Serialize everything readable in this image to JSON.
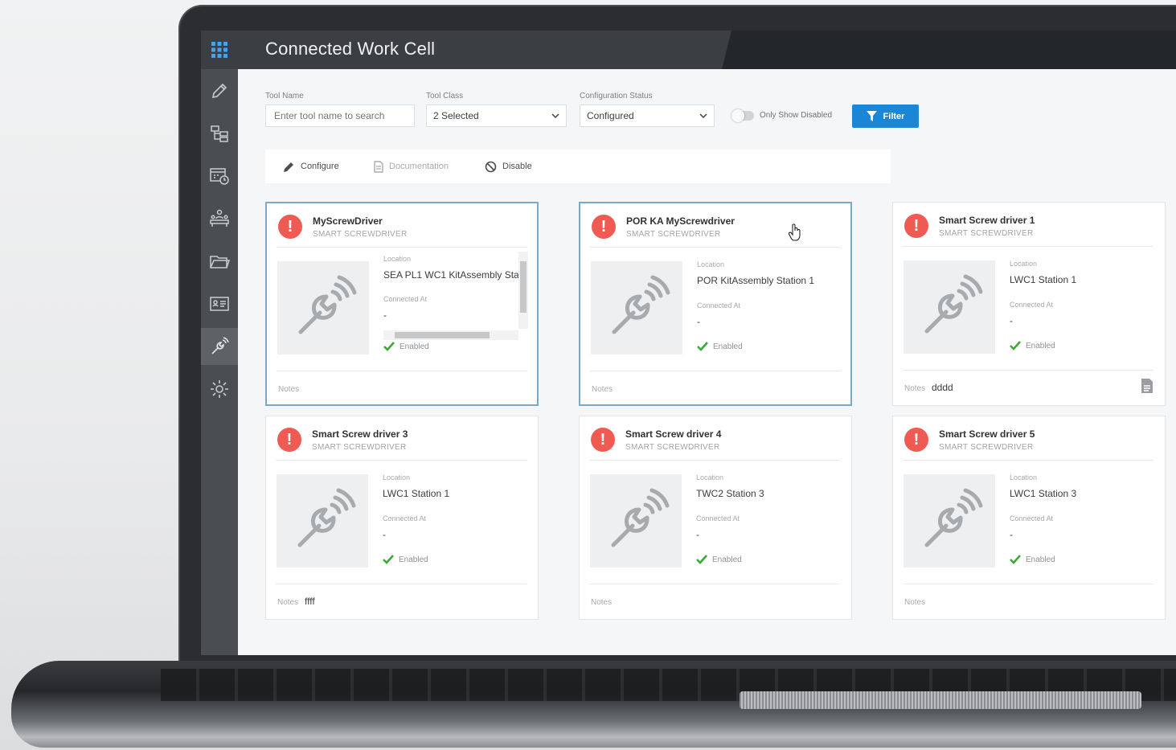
{
  "app": {
    "title": "Connected Work Cell"
  },
  "sidebar": {
    "items": [
      {
        "icon": "pencil-icon"
      },
      {
        "icon": "hierarchy-icon"
      },
      {
        "icon": "schedule-icon"
      },
      {
        "icon": "workstation-icon"
      },
      {
        "icon": "folder-icon"
      },
      {
        "icon": "id-card-icon"
      },
      {
        "icon": "smart-tool-icon",
        "active": true
      },
      {
        "icon": "gear-icon"
      }
    ]
  },
  "filters": {
    "tool_name": {
      "label": "Tool Name",
      "placeholder": "Enter tool name to search"
    },
    "tool_class": {
      "label": "Tool Class",
      "value": "2 Selected"
    },
    "config_status": {
      "label": "Configuration Status",
      "value": "Configured"
    },
    "only_disabled": {
      "label": "Only Show Disabled",
      "on": false
    },
    "filter_button": "Filter"
  },
  "actions": {
    "configure": "Configure",
    "documentation": "Documentation",
    "disable": "Disable"
  },
  "card_labels": {
    "location": "Location",
    "connected_at": "Connected At",
    "notes": "Notes"
  },
  "cards": [
    {
      "name": "MyScrewDriver",
      "type": "SMART SCREWDRIVER",
      "location": "SEA PL1 WC1 KitAssembly Stat",
      "connected_at": "-",
      "status": "Enabled",
      "notes": ""
    },
    {
      "name": "POR KA MyScrewdriver",
      "type": "SMART SCREWDRIVER",
      "location": "POR KitAssembly Station 1",
      "connected_at": "-",
      "status": "Enabled",
      "notes": ""
    },
    {
      "name": "Smart Screw driver 1",
      "type": "SMART SCREWDRIVER",
      "location": "LWC1 Station 1",
      "connected_at": "-",
      "status": "Enabled",
      "notes": "dddd"
    },
    {
      "name": "Smart Screw driver 3",
      "type": "SMART SCREWDRIVER",
      "location": "LWC1 Station 1",
      "connected_at": "-",
      "status": "Enabled",
      "notes": "ffff"
    },
    {
      "name": "Smart Screw driver 4",
      "type": "SMART SCREWDRIVER",
      "location": "TWC2 Station 3",
      "connected_at": "-",
      "status": "Enabled",
      "notes": ""
    },
    {
      "name": "Smart Screw driver 5",
      "type": "SMART SCREWDRIVER",
      "location": "LWC1 Station 3",
      "connected_at": "-",
      "status": "Enabled",
      "notes": ""
    }
  ],
  "colors": {
    "accent": "#1b86d6",
    "alert": "#ef5a52",
    "enabled": "#3aaa35",
    "topbar": "#3b3e42",
    "sidebar": "#4a4d51"
  }
}
